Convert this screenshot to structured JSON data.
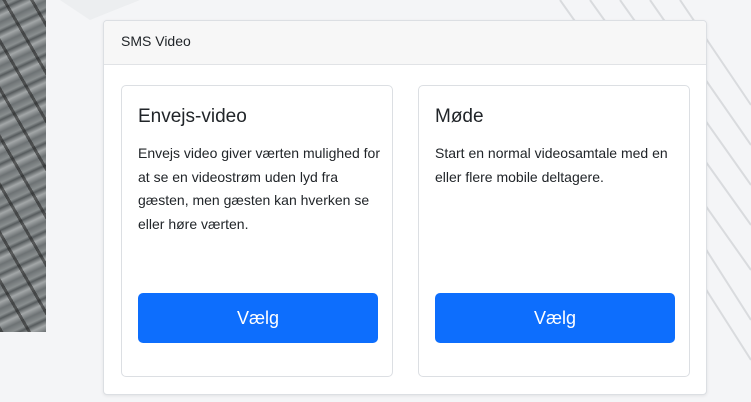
{
  "panel": {
    "title": "SMS Video"
  },
  "cards": [
    {
      "title": "Envejs-video",
      "description": "Envejs video giver værten mulighed for at se en videostrøm uden lyd fra gæsten, men gæsten kan hverken se eller høre værten.",
      "button_label": "Vælg"
    },
    {
      "title": "Møde",
      "description": "Start en normal videosamtale med en eller flere mobile deltagere.",
      "button_label": "Vælg"
    }
  ],
  "colors": {
    "primary_button": "#0d6efd",
    "panel_header_bg": "#f7f7f7"
  }
}
